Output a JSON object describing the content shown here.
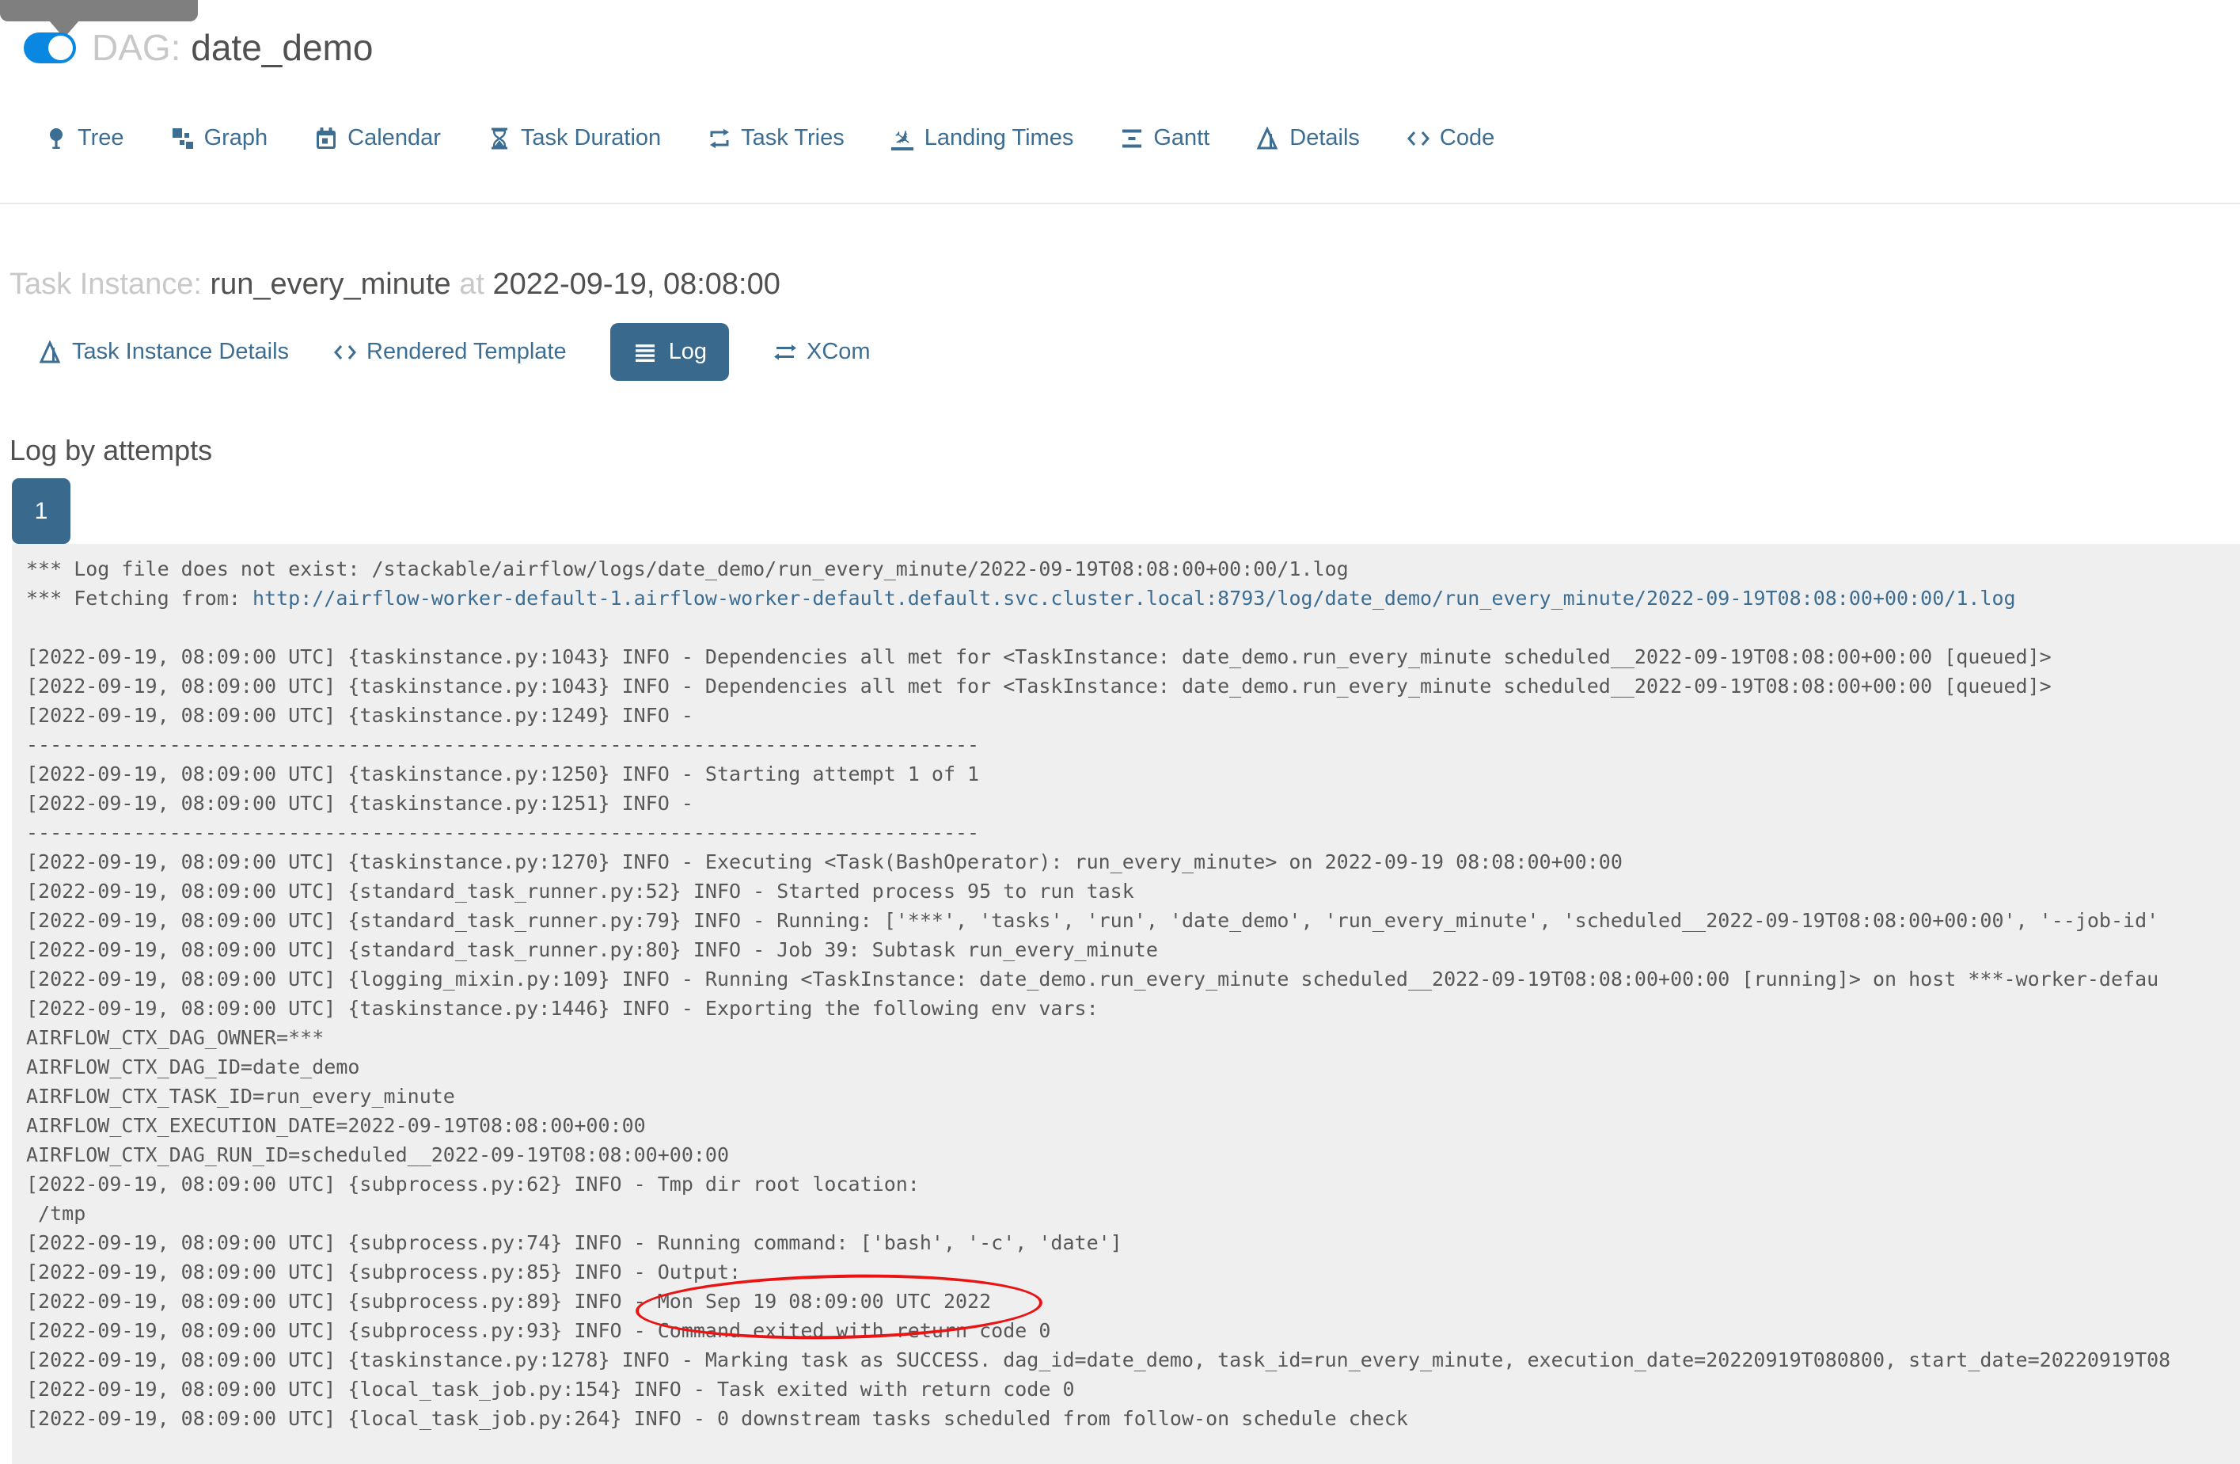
{
  "header": {
    "dag_label": "DAG:",
    "dag_name": "date_demo",
    "toggle_state": "on"
  },
  "nav_tabs": [
    {
      "label": "Tree",
      "icon": "pin-icon"
    },
    {
      "label": "Graph",
      "icon": "graph-icon"
    },
    {
      "label": "Calendar",
      "icon": "calendar-icon"
    },
    {
      "label": "Task Duration",
      "icon": "hourglass-icon"
    },
    {
      "label": "Task Tries",
      "icon": "repeat-icon"
    },
    {
      "label": "Landing Times",
      "icon": "plane-landing-icon"
    },
    {
      "label": "Gantt",
      "icon": "gantt-icon"
    },
    {
      "label": "Details",
      "icon": "details-icon"
    },
    {
      "label": "Code",
      "icon": "code-icon"
    }
  ],
  "task_instance": {
    "label": "Task Instance:",
    "name": "run_every_minute",
    "at_label": "at",
    "datetime": "2022-09-19, 08:08:00"
  },
  "instance_tabs": {
    "details": "Task Instance Details",
    "rendered": "Rendered Template",
    "log": "Log",
    "xcom": "XCom"
  },
  "log_section": {
    "heading": "Log by attempts",
    "attempt_label": "1"
  },
  "colors": {
    "accent_blue": "#3c6d92",
    "active_button": "#3a698e",
    "toggle_blue": "#0a87e0",
    "log_background": "#efefef",
    "annotation_red": "#ea1414"
  },
  "log": {
    "lines": [
      {
        "t": "*** Log file does not exist: /stackable/airflow/logs/date_demo/run_every_minute/2022-09-19T08:08:00+00:00/1.log"
      },
      {
        "pre": "*** Fetching from: ",
        "link": "http://airflow-worker-default-1.airflow-worker-default.default.svc.cluster.local:8793/log/date_demo/run_every_minute/2022-09-19T08:08:00+00:00/1.log"
      },
      {
        "t": ""
      },
      {
        "t": "[2022-09-19, 08:09:00 UTC] {taskinstance.py:1043} INFO - Dependencies all met for <TaskInstance: date_demo.run_every_minute scheduled__2022-09-19T08:08:00+00:00 [queued]>"
      },
      {
        "t": "[2022-09-19, 08:09:00 UTC] {taskinstance.py:1043} INFO - Dependencies all met for <TaskInstance: date_demo.run_every_minute scheduled__2022-09-19T08:08:00+00:00 [queued]>"
      },
      {
        "t": "[2022-09-19, 08:09:00 UTC] {taskinstance.py:1249} INFO - "
      },
      {
        "t": "--------------------------------------------------------------------------------"
      },
      {
        "t": "[2022-09-19, 08:09:00 UTC] {taskinstance.py:1250} INFO - Starting attempt 1 of 1"
      },
      {
        "t": "[2022-09-19, 08:09:00 UTC] {taskinstance.py:1251} INFO - "
      },
      {
        "t": "--------------------------------------------------------------------------------"
      },
      {
        "t": "[2022-09-19, 08:09:00 UTC] {taskinstance.py:1270} INFO - Executing <Task(BashOperator): run_every_minute> on 2022-09-19 08:08:00+00:00"
      },
      {
        "t": "[2022-09-19, 08:09:00 UTC] {standard_task_runner.py:52} INFO - Started process 95 to run task"
      },
      {
        "t": "[2022-09-19, 08:09:00 UTC] {standard_task_runner.py:79} INFO - Running: ['***', 'tasks', 'run', 'date_demo', 'run_every_minute', 'scheduled__2022-09-19T08:08:00+00:00', '--job-id'"
      },
      {
        "t": "[2022-09-19, 08:09:00 UTC] {standard_task_runner.py:80} INFO - Job 39: Subtask run_every_minute"
      },
      {
        "t": "[2022-09-19, 08:09:00 UTC] {logging_mixin.py:109} INFO - Running <TaskInstance: date_demo.run_every_minute scheduled__2022-09-19T08:08:00+00:00 [running]> on host ***-worker-defau"
      },
      {
        "t": "[2022-09-19, 08:09:00 UTC] {taskinstance.py:1446} INFO - Exporting the following env vars:"
      },
      {
        "t": "AIRFLOW_CTX_DAG_OWNER=***"
      },
      {
        "t": "AIRFLOW_CTX_DAG_ID=date_demo"
      },
      {
        "t": "AIRFLOW_CTX_TASK_ID=run_every_minute"
      },
      {
        "t": "AIRFLOW_CTX_EXECUTION_DATE=2022-09-19T08:08:00+00:00"
      },
      {
        "t": "AIRFLOW_CTX_DAG_RUN_ID=scheduled__2022-09-19T08:08:00+00:00"
      },
      {
        "t": "[2022-09-19, 08:09:00 UTC] {subprocess.py:62} INFO - Tmp dir root location: "
      },
      {
        "t": " /tmp"
      },
      {
        "t": "[2022-09-19, 08:09:00 UTC] {subprocess.py:74} INFO - Running command: ['bash', '-c', 'date']"
      },
      {
        "t": "[2022-09-19, 08:09:00 UTC] {subprocess.py:85} INFO - Output:"
      },
      {
        "pre": "[2022-09-19, 08:09:00 UTC] {subprocess.py:89} INFO ",
        "circled": "- Mon Sep 19 08:09:00 UTC 2022"
      },
      {
        "t": "[2022-09-19, 08:09:00 UTC] {subprocess.py:93} INFO - Command exited with return code 0"
      },
      {
        "t": "[2022-09-19, 08:09:00 UTC] {taskinstance.py:1278} INFO - Marking task as SUCCESS. dag_id=date_demo, task_id=run_every_minute, execution_date=20220919T080800, start_date=20220919T08"
      },
      {
        "t": "[2022-09-19, 08:09:00 UTC] {local_task_job.py:154} INFO - Task exited with return code 0"
      },
      {
        "t": "[2022-09-19, 08:09:00 UTC] {local_task_job.py:264} INFO - 0 downstream tasks scheduled from follow-on schedule check"
      }
    ]
  }
}
